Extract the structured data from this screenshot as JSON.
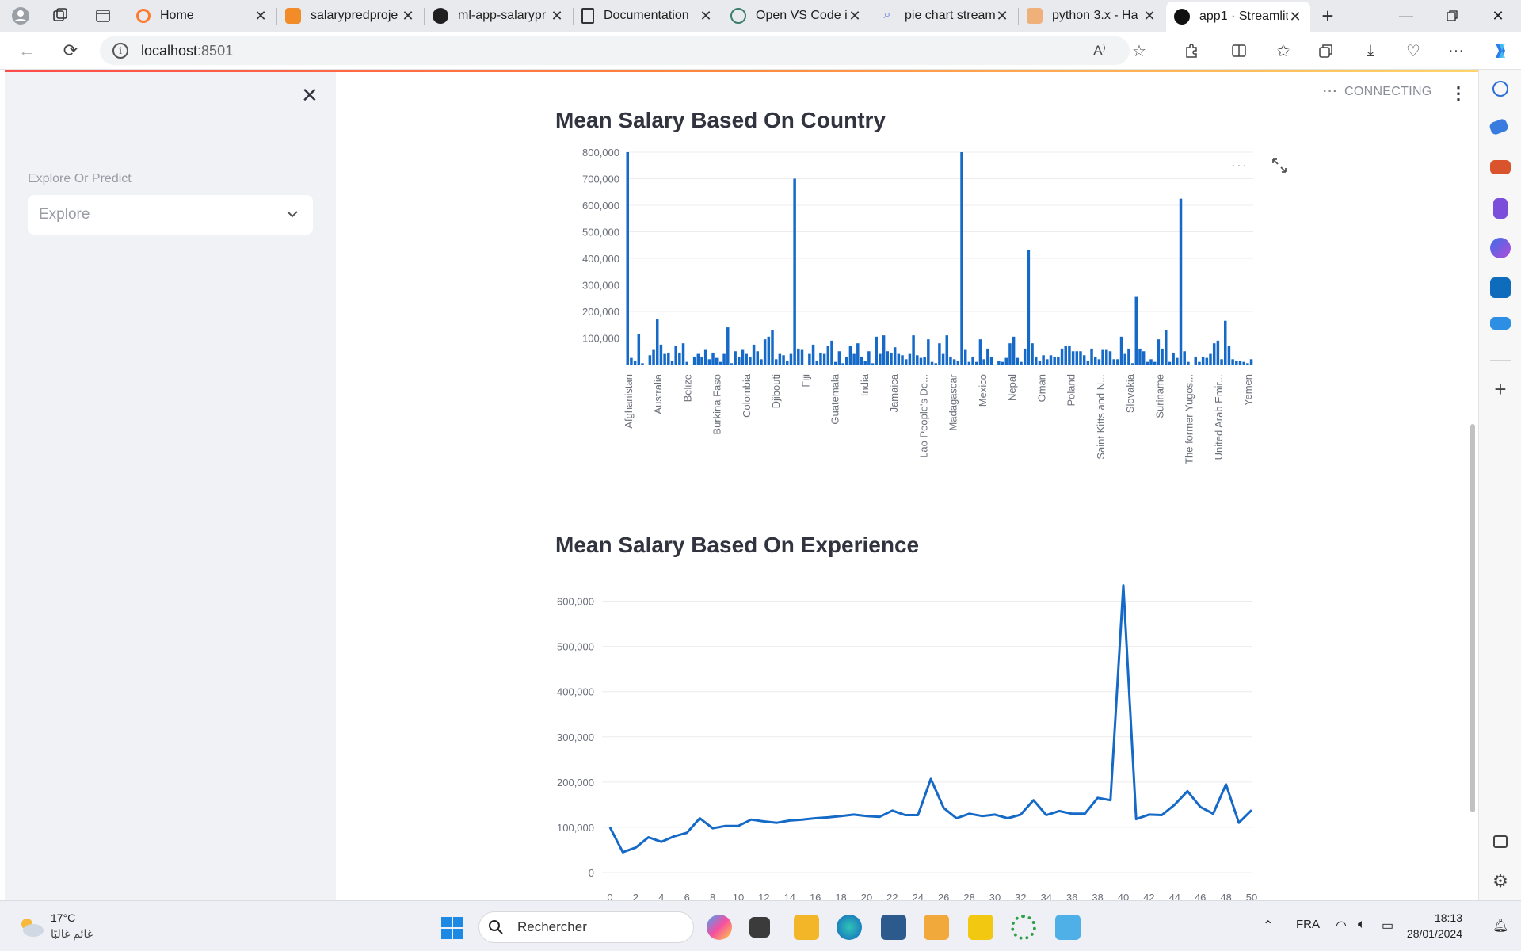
{
  "browser": {
    "tabs": [
      {
        "label": "Home",
        "active": false
      },
      {
        "label": "salarypredproje",
        "active": false
      },
      {
        "label": "ml-app-salarypr",
        "active": false
      },
      {
        "label": "Documentation",
        "active": false
      },
      {
        "label": "Open VS Code i",
        "active": false
      },
      {
        "label": "pie chart stream",
        "active": false
      },
      {
        "label": "python 3.x - Ha",
        "active": false
      },
      {
        "label": "app1 · Streamlit",
        "active": true
      }
    ],
    "url_host": "localhost",
    "url_port": ":8501"
  },
  "sidebar": {
    "select_label": "Explore Or Predict",
    "select_value": "Explore"
  },
  "status": {
    "connecting": "CONNECTING"
  },
  "main": {
    "country_title": "Mean Salary Based On Country",
    "experience_title": "Mean Salary Based On Experience"
  },
  "chart_data": [
    {
      "type": "bar",
      "title": "Mean Salary Based On Country",
      "xlabel": "",
      "ylabel": "",
      "ylim": [
        0,
        800000
      ],
      "yticks": [
        "100,000",
        "200,000",
        "300,000",
        "400,000",
        "500,000",
        "600,000",
        "700,000",
        "800,000"
      ],
      "tick_categories": [
        "Afghanistan",
        "Australia",
        "Belize",
        "Burkina Faso",
        "Colombia",
        "Djibouti",
        "Fiji",
        "Guatemala",
        "India",
        "Jamaica",
        "Lao People's De...",
        "Madagascar",
        "Mexico",
        "Nepal",
        "Oman",
        "Poland",
        "Saint Kitts and N...",
        "Slovakia",
        "Suriname",
        "The former Yugos...",
        "United Arab Emir...",
        "Yemen"
      ],
      "values": [
        800000,
        25000,
        15000,
        115000,
        5000,
        0,
        35000,
        55000,
        170000,
        75000,
        40000,
        45000,
        15000,
        70000,
        45000,
        80000,
        10000,
        0,
        30000,
        40000,
        30000,
        55000,
        20000,
        45000,
        25000,
        10000,
        40000,
        140000,
        5000,
        50000,
        30000,
        55000,
        40000,
        30000,
        75000,
        50000,
        20000,
        95000,
        105000,
        130000,
        20000,
        40000,
        35000,
        15000,
        40000,
        700000,
        60000,
        55000,
        0,
        40000,
        75000,
        15000,
        45000,
        40000,
        70000,
        90000,
        10000,
        50000,
        5000,
        30000,
        70000,
        40000,
        80000,
        30000,
        15000,
        50000,
        5000,
        105000,
        40000,
        110000,
        50000,
        45000,
        65000,
        40000,
        35000,
        20000,
        40000,
        110000,
        35000,
        25000,
        30000,
        95000,
        10000,
        5000,
        80000,
        40000,
        110000,
        30000,
        20000,
        15000,
        800000,
        55000,
        10000,
        30000,
        10000,
        95000,
        20000,
        60000,
        30000,
        0,
        15000,
        10000,
        25000,
        80000,
        105000,
        25000,
        10000,
        60000,
        430000,
        80000,
        30000,
        15000,
        35000,
        20000,
        35000,
        30000,
        30000,
        60000,
        70000,
        70000,
        50000,
        50000,
        50000,
        35000,
        15000,
        60000,
        30000,
        20000,
        55000,
        55000,
        50000,
        20000,
        20000,
        105000,
        40000,
        60000,
        5000,
        255000,
        60000,
        50000,
        10000,
        20000,
        10000,
        95000,
        60000,
        130000,
        10000,
        45000,
        25000,
        625000,
        50000,
        10000,
        0,
        30000,
        10000,
        30000,
        25000,
        40000,
        80000,
        90000,
        20000,
        165000,
        70000,
        20000,
        15000,
        15000,
        10000,
        5000,
        20000
      ]
    },
    {
      "type": "line",
      "title": "Mean Salary Based On Experience",
      "xlabel": "",
      "ylabel": "",
      "ylim": [
        0,
        650000
      ],
      "yticks": [
        "0",
        "100,000",
        "200,000",
        "300,000",
        "400,000",
        "500,000",
        "600,000"
      ],
      "xticks": [
        "0",
        "2",
        "4",
        "6",
        "8",
        "10",
        "12",
        "14",
        "16",
        "18",
        "20",
        "22",
        "24",
        "26",
        "28",
        "30",
        "32",
        "34",
        "36",
        "38",
        "40",
        "42",
        "44",
        "46",
        "48",
        "50"
      ],
      "x": [
        0,
        1,
        2,
        3,
        4,
        5,
        6,
        7,
        8,
        9,
        10,
        11,
        12,
        13,
        14,
        15,
        16,
        17,
        18,
        19,
        20,
        21,
        22,
        23,
        24,
        25,
        26,
        27,
        28,
        29,
        30,
        31,
        32,
        33,
        34,
        35,
        36,
        37,
        38,
        39,
        40,
        41,
        42,
        43,
        44,
        45,
        46,
        47,
        48,
        49,
        50
      ],
      "y": [
        100000,
        45000,
        55000,
        78000,
        68000,
        80000,
        88000,
        120000,
        98000,
        103000,
        103000,
        117000,
        113000,
        110000,
        115000,
        117000,
        120000,
        122000,
        125000,
        128000,
        125000,
        123000,
        137000,
        127000,
        127000,
        207000,
        143000,
        120000,
        130000,
        125000,
        128000,
        120000,
        128000,
        160000,
        127000,
        136000,
        130000,
        130000,
        165000,
        160000,
        635000,
        118000,
        128000,
        127000,
        150000,
        180000,
        145000,
        130000,
        195000,
        110000,
        138000
      ]
    }
  ],
  "taskbar": {
    "temperature": "17°C",
    "condition": "غائم غالبًا",
    "search_placeholder": "Rechercher",
    "language": "FRA",
    "time": "18:13",
    "date": "28/01/2024"
  }
}
